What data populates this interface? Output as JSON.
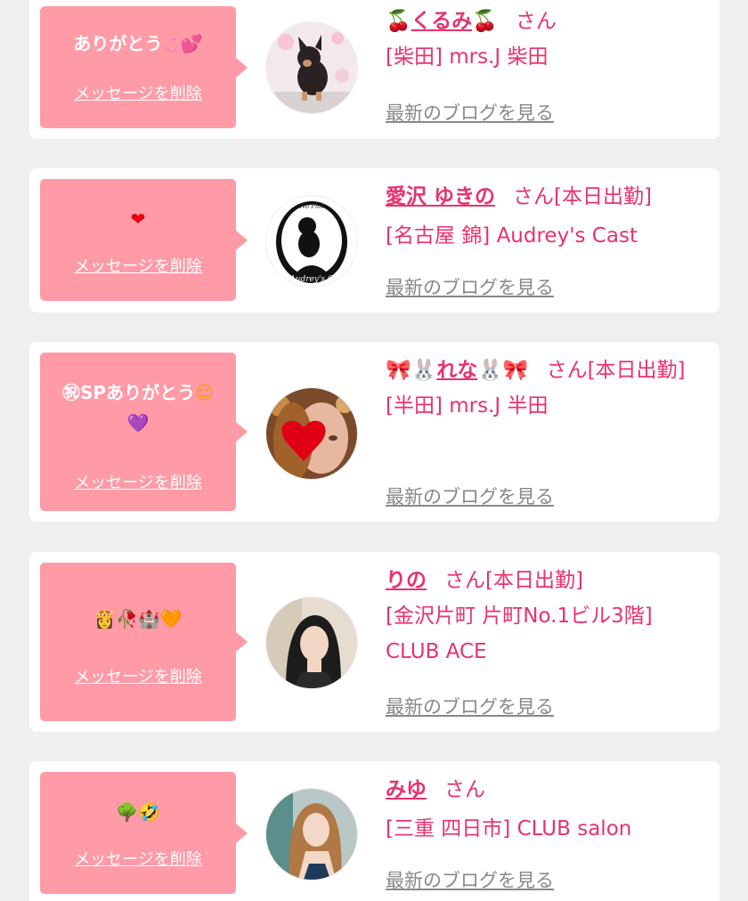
{
  "delete_label": "メッセージを削除",
  "blog_label": "最新のブログを見る",
  "san_label": "さん",
  "cards": [
    {
      "message": "ありがとう",
      "message_icons": [
        "smile-icon",
        "two-hearts-icon"
      ],
      "name": "くるみ",
      "name_icons": [
        "cherry-icon",
        "cherry-icon"
      ],
      "suffix": "",
      "shop": "[柴田] mrs.J 柴田",
      "avatar": "dog-photo"
    },
    {
      "message": "",
      "message_icons": [
        "heart-icon"
      ],
      "name": "愛沢 ゆきの",
      "name_icons": [],
      "suffix": "[本日出勤]",
      "shop": "[名古屋 錦] Audrey's Cast",
      "avatar": "audrey-logo"
    },
    {
      "message": "㊗SPありがとう",
      "message_icons": [
        "smile-icon",
        "heart-icon"
      ],
      "name": "れな",
      "name_icons": [
        "ribbon-icon",
        "rabbit-icon",
        "rabbit-icon",
        "ribbon-icon"
      ],
      "suffix": "[本日出勤]",
      "shop": "[半田] mrs.J 半田",
      "avatar": "girl-heart-photo"
    },
    {
      "message": "",
      "message_icons": [
        "princess-icon",
        "rose-icon",
        "castle-icon",
        "heart-icon"
      ],
      "name": "りの",
      "name_icons": [],
      "suffix": "[本日出勤]",
      "shop": "[金沢片町 片町No.1ビル3階] CLUB ACE",
      "avatar": "girl-photo"
    },
    {
      "message": "",
      "message_icons": [
        "tree-icon",
        "ok-face-icon"
      ],
      "name": "みゆ",
      "name_icons": [],
      "suffix": "",
      "shop": "[三重 四日市] CLUB salon",
      "avatar": "girl-photo"
    }
  ],
  "colors": {
    "bubble": "#ff9aa7",
    "accent": "#e8326d",
    "link_gray": "#888888",
    "background": "#efefef"
  }
}
